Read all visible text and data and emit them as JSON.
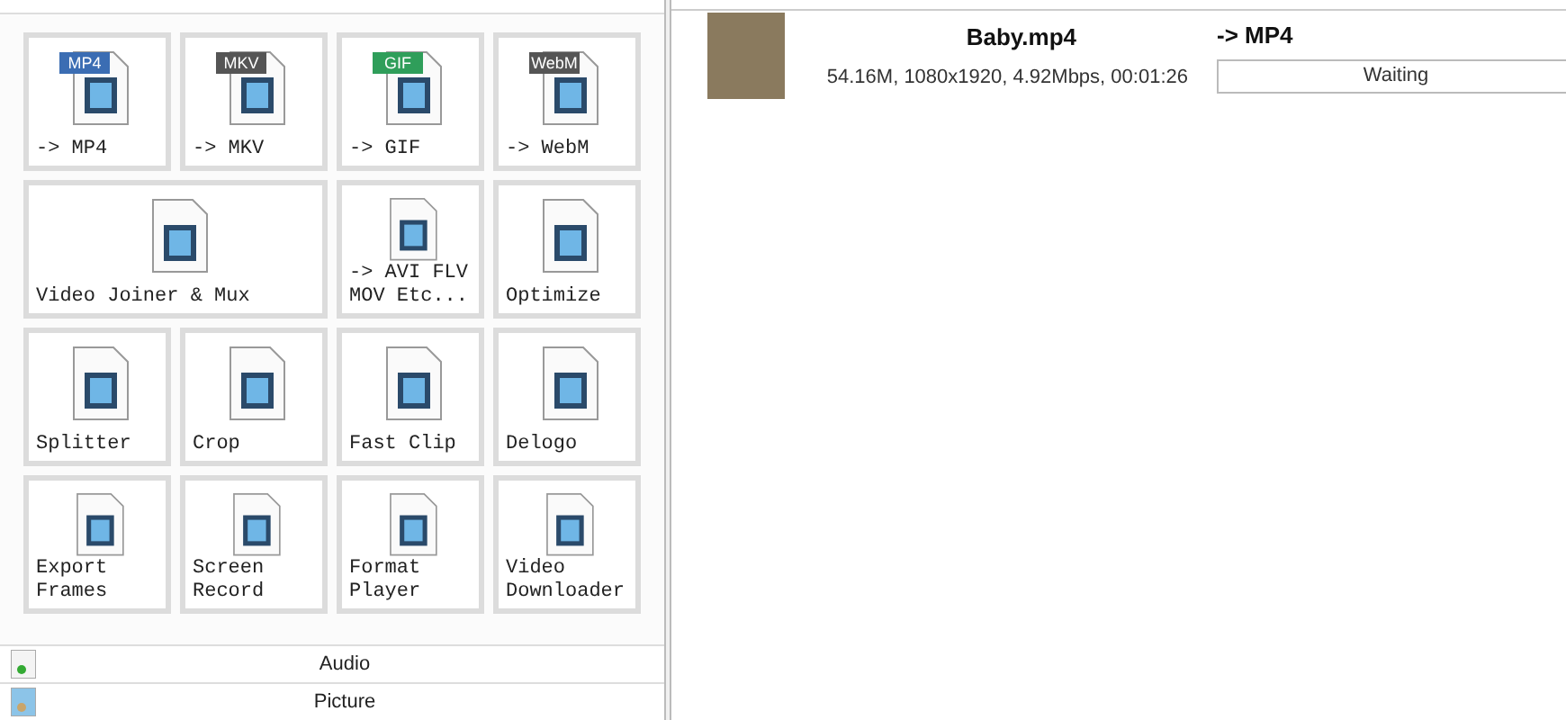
{
  "tools": [
    {
      "label": "-> MP4",
      "wide": false,
      "badge": "MP4",
      "color": "#3b6db3"
    },
    {
      "label": "-> MKV",
      "wide": false,
      "badge": "MKV",
      "color": "#555555"
    },
    {
      "label": "-> GIF",
      "wide": false,
      "badge": "GIF",
      "color": "#2f9e5a"
    },
    {
      "label": "-> WebM",
      "wide": false,
      "badge": "WebM",
      "color": "#555555"
    },
    {
      "label": "Video Joiner & Mux",
      "wide": true
    },
    {
      "label": "-> AVI FLV MOV Etc...",
      "wide": false
    },
    {
      "label": "Optimize",
      "wide": false
    },
    {
      "label": "Splitter",
      "wide": false
    },
    {
      "label": "Crop",
      "wide": false
    },
    {
      "label": "Fast Clip",
      "wide": false
    },
    {
      "label": "Delogo",
      "wide": false
    },
    {
      "label": "Export Frames",
      "wide": false
    },
    {
      "label": "Screen Record",
      "wide": false
    },
    {
      "label": "Format Player",
      "wide": false
    },
    {
      "label": "Video Downloader",
      "wide": false
    }
  ],
  "sections": [
    "Audio",
    "Picture"
  ],
  "file": {
    "name": "Baby.mp4",
    "info": "54.16M, 1080x1920, 4.92Mbps, 00:01:26",
    "target": "-> MP4",
    "status": "Waiting"
  }
}
